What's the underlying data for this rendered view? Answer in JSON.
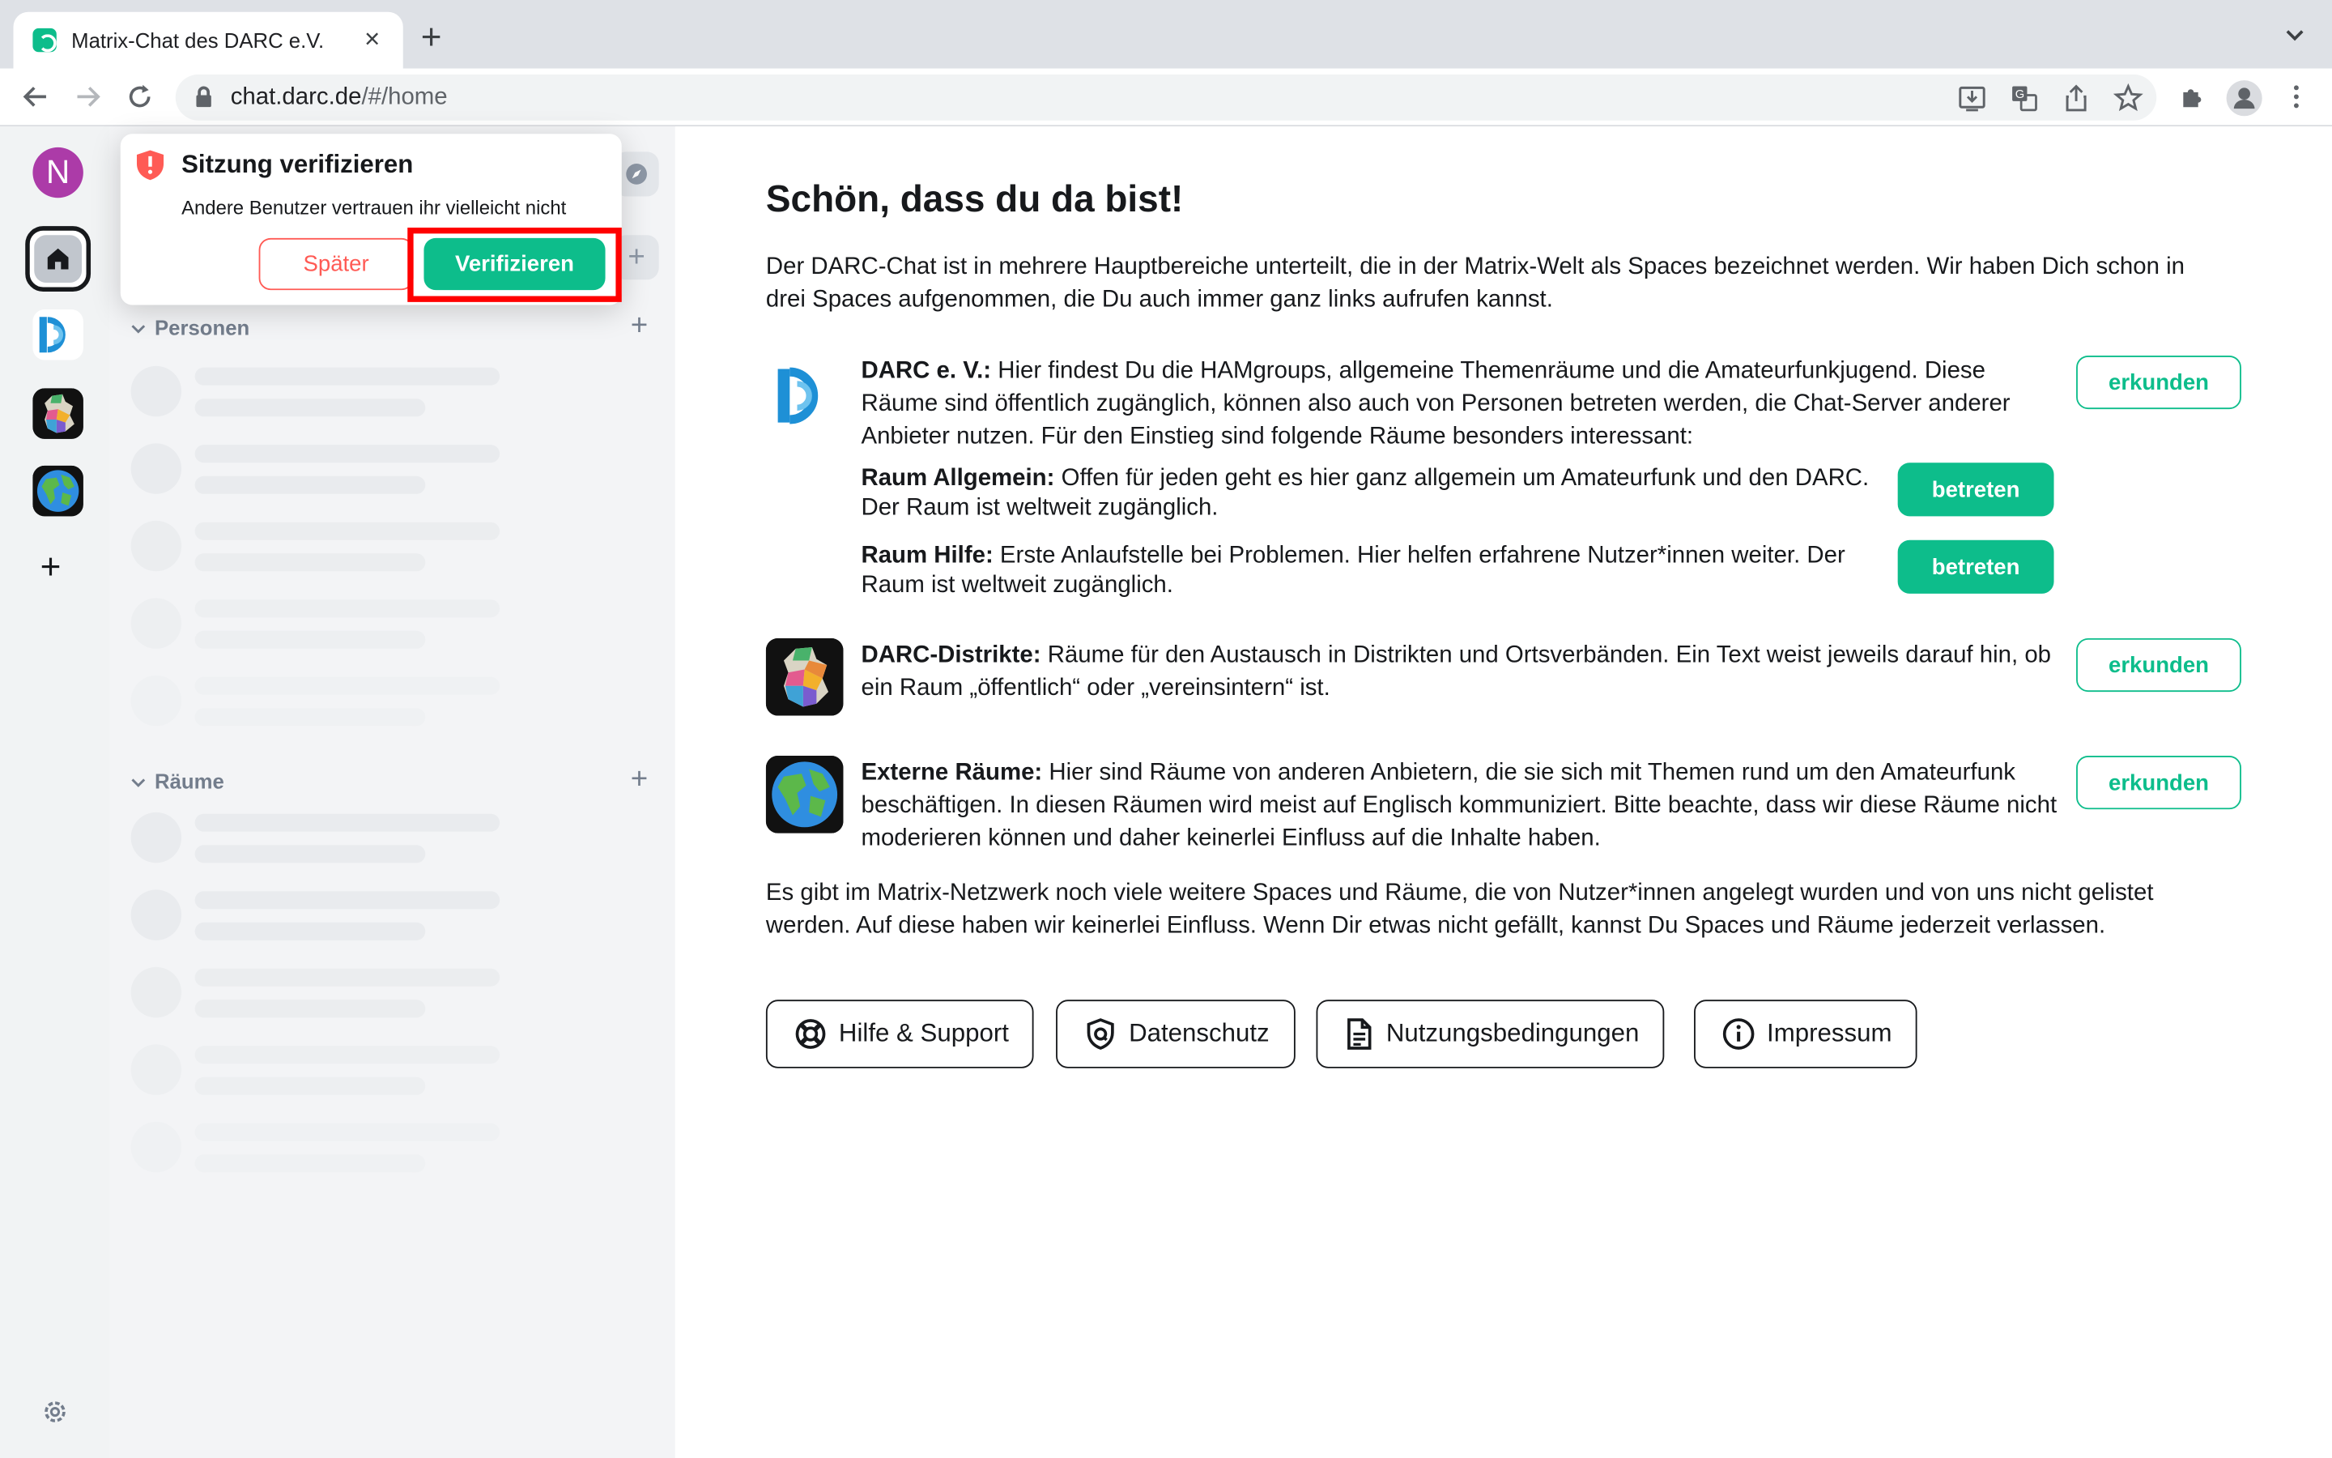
{
  "browser": {
    "tab_title": "Matrix-Chat des DARC e.V.",
    "url_host": "chat.darc.de",
    "url_path": "/#/home"
  },
  "space_panel": {
    "user_initial": "N"
  },
  "roomlist": {
    "section_people": "Personen",
    "section_rooms": "Räume"
  },
  "toast": {
    "title": "Sitzung verifizieren",
    "description": "Andere Benutzer vertrauen ihr vielleicht nicht",
    "later_label": "Später",
    "verify_label": "Verifizieren"
  },
  "main": {
    "title": "Schön, dass du da bist!",
    "intro": "Der DARC-Chat ist in mehrere Hauptbereiche unterteilt, die in der Matrix-Welt als Spaces bezeichnet werden. Wir haben Dich schon in drei Spaces aufgenommen, die Du auch immer ganz links aufrufen kannst.",
    "darc": {
      "name": "DARC e. V.:",
      "text": " Hier findest Du die HAMgroups, allgemeine Themenräume und die Amateurfunkjugend. Diese Räume sind öffentlich zugänglich, können also auch von Personen betreten werden, die Chat-Server anderer Anbieter nutzen. Für den Einstieg sind folgende Räume besonders interessant:",
      "explore_label": "erkunden",
      "rooms": [
        {
          "name": "Raum Allgemein:",
          "text": " Offen für jeden geht es hier ganz allgemein um Amateurfunk und den DARC. Der Raum ist weltweit zugänglich.",
          "join_label": "betreten"
        },
        {
          "name": "Raum Hilfe:",
          "text": " Erste Anlaufstelle bei Problemen. Hier helfen erfahrene Nutzer*innen weiter. Der Raum ist weltweit zugänglich.",
          "join_label": "betreten"
        }
      ]
    },
    "districts": {
      "name": "DARC-Distrikte:",
      "text": " Räume für den Austausch in Distrikten und Ortsverbänden. Ein Text weist jeweils darauf hin, ob ein Raum „öffentlich“ oder „vereinsintern“ ist.",
      "explore_label": "erkunden"
    },
    "external": {
      "name": "Externe Räume:",
      "text": " Hier sind Räume von anderen Anbietern, die sie sich mit Themen rund um den Amateurfunk beschäftigen. In diesen Räumen wird meist auf Englisch kommuniziert. Bitte beachte, dass wir diese Räume nicht moderieren können und daher keinerlei Einfluss auf die Inhalte haben.",
      "explore_label": "erkunden"
    },
    "outro": "Es gibt im Matrix-Netzwerk noch viele weitere Spaces und Räume, die von Nutzer*innen angelegt wurden und von uns nicht gelistet werden. Auf diese haben wir keinerlei Einfluss. Wenn Dir etwas nicht gefällt, kannst Du Spaces und Räume jederzeit verlassen.",
    "footer": {
      "help": "Hilfe & Support",
      "privacy": "Datenschutz",
      "terms": "Nutzungsbedingungen",
      "imprint": "Impressum"
    }
  },
  "colors": {
    "accent": "#0dbd8b",
    "alert": "#ff5b55",
    "highlight": "#ff0000",
    "avatar": "#ac3ba8"
  }
}
